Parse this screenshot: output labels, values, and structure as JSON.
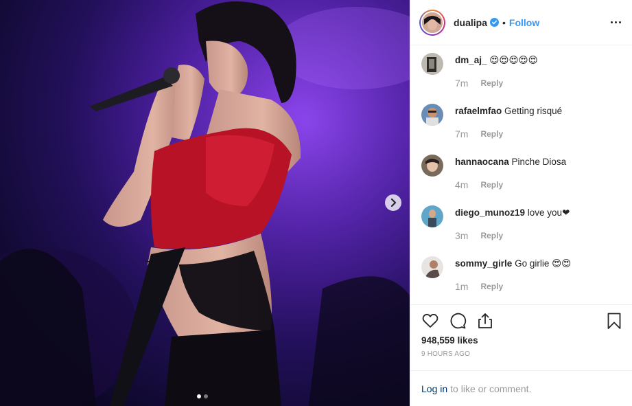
{
  "post": {
    "username": "dualipa",
    "bullet": "•",
    "follow_label": "Follow",
    "verified_icon": "verified-badge-icon",
    "more_icon": "more-options-icon"
  },
  "comments": [
    {
      "user": "dm_aj_",
      "text": "😍😍😍😍😍",
      "time": "7m",
      "reply": "Reply"
    },
    {
      "user": "rafaelmfao",
      "text": "Getting risqué",
      "time": "7m",
      "reply": "Reply"
    },
    {
      "user": "hannaocana",
      "text": "Pinche Diosa",
      "time": "4m",
      "reply": "Reply"
    },
    {
      "user": "diego_munoz19",
      "text": "love you❤",
      "time": "3m",
      "reply": "Reply"
    },
    {
      "user": "sommy_girle",
      "text": "Go girlie 😍😍",
      "time": "1m",
      "reply": "Reply"
    }
  ],
  "actions": {
    "like_icon": "heart-icon",
    "comment_icon": "comment-icon",
    "share_icon": "share-icon",
    "save_icon": "bookmark-icon"
  },
  "likes": "948,559 likes",
  "posted": "9 HOURS AGO",
  "login": {
    "link": "Log in",
    "rest": "to like or comment."
  },
  "carousel": {
    "next_icon": "chevron-right-icon",
    "current": 1,
    "total": 2
  },
  "colors": {
    "link_blue": "#3897f0",
    "login_link": "#003569",
    "border": "#efefef",
    "muted": "#999999"
  }
}
